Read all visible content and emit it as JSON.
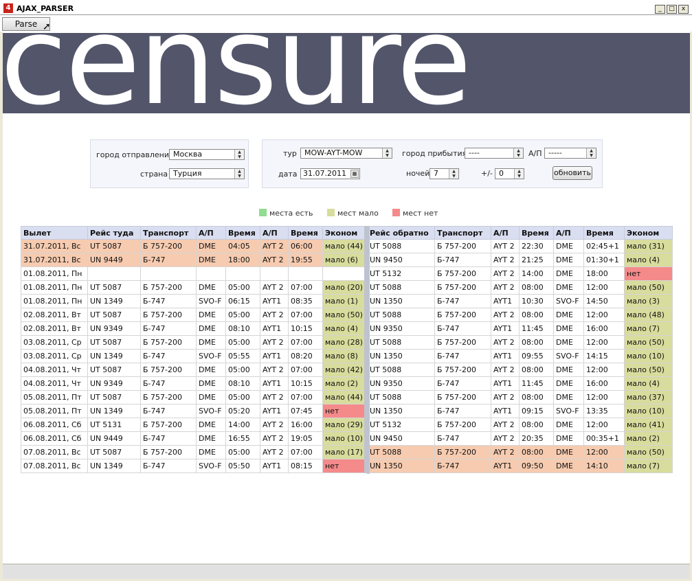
{
  "window": {
    "title": "AJAX_PARSER",
    "app_icon": "4",
    "min_glyph": "_",
    "max_glyph": "□",
    "close_glyph": "x"
  },
  "toolbar": {
    "parse_label": "Parse"
  },
  "banner": {
    "logo_text": "censure"
  },
  "form": {
    "departure_city_label": "город отправления",
    "departure_city_value": "Москва",
    "country_label": "страна",
    "country_value": "Турция",
    "tour_label": "тур",
    "tour_value": "MOW-AYT-MOW",
    "arrival_city_label": "город прибытия",
    "arrival_city_value": "----",
    "airport_label": "А/П",
    "airport_value": "-----",
    "date_label": "дата",
    "date_value": "31.07.2011",
    "nights_label": "ночей",
    "nights_value": "7",
    "plusminus_label": "+/-",
    "plusminus_value": "0",
    "refresh_label": "обновить"
  },
  "legend": {
    "available": "места есть",
    "few": "мест мало",
    "none": "мест нет",
    "colors": {
      "available": "#90dc90",
      "few": "#d8dc9c",
      "none": "#f58a8a",
      "highlight": "#f6cbb0"
    }
  },
  "table": {
    "columns": [
      "Вылет",
      "Рейс туда",
      "Транспорт",
      "А/П",
      "Время",
      "А/П",
      "Время",
      "Эконом",
      "Рейс обратно",
      "Транспорт",
      "А/П",
      "Время",
      "А/П",
      "Время",
      "Эконом"
    ],
    "rows": [
      {
        "hl_left": true,
        "hl_right": false,
        "cells": [
          "31.07.2011, Вс",
          "UT 5087",
          "Б 757-200",
          "DME",
          "04:05",
          "AYT 2",
          "06:00",
          "мало (44)",
          "UT 5088",
          "Б 757-200",
          "AYT 2",
          "22:30",
          "DME",
          "02:45+1",
          "мало (31)"
        ]
      },
      {
        "hl_left": true,
        "hl_right": false,
        "cells": [
          "31.07.2011, Вс",
          "UN 9449",
          "Б-747",
          "DME",
          "18:00",
          "AYT 2",
          "19:55",
          "мало (6)",
          "UN 9450",
          "Б-747",
          "AYT 2",
          "21:25",
          "DME",
          "01:30+1",
          "мало (4)"
        ]
      },
      {
        "hl_left": false,
        "hl_right": false,
        "cells": [
          "01.08.2011, Пн",
          "",
          "",
          "",
          "",
          "",
          "",
          "",
          "UT 5132",
          "Б 757-200",
          "AYT 2",
          "14:00",
          "DME",
          "18:00",
          "нет"
        ]
      },
      {
        "hl_left": false,
        "hl_right": false,
        "cells": [
          "01.08.2011, Пн",
          "UT 5087",
          "Б 757-200",
          "DME",
          "05:00",
          "AYT 2",
          "07:00",
          "мало (20)",
          "UT 5088",
          "Б 757-200",
          "AYT 2",
          "08:00",
          "DME",
          "12:00",
          "мало (50)"
        ]
      },
      {
        "hl_left": false,
        "hl_right": false,
        "cells": [
          "01.08.2011, Пн",
          "UN 1349",
          "Б-747",
          "SVO-F",
          "06:15",
          "AYT1",
          "08:35",
          "мало (1)",
          "UN 1350",
          "Б-747",
          "AYT1",
          "10:30",
          "SVO-F",
          "14:50",
          "мало (3)"
        ]
      },
      {
        "hl_left": false,
        "hl_right": false,
        "cells": [
          "02.08.2011, Вт",
          "UT 5087",
          "Б 757-200",
          "DME",
          "05:00",
          "AYT 2",
          "07:00",
          "мало (50)",
          "UT 5088",
          "Б 757-200",
          "AYT 2",
          "08:00",
          "DME",
          "12:00",
          "мало (48)"
        ]
      },
      {
        "hl_left": false,
        "hl_right": false,
        "cells": [
          "02.08.2011, Вт",
          "UN 9349",
          "Б-747",
          "DME",
          "08:10",
          "AYT1",
          "10:15",
          "мало (4)",
          "UN 9350",
          "Б-747",
          "AYT1",
          "11:45",
          "DME",
          "16:00",
          "мало (7)"
        ]
      },
      {
        "hl_left": false,
        "hl_right": false,
        "cells": [
          "03.08.2011, Ср",
          "UT 5087",
          "Б 757-200",
          "DME",
          "05:00",
          "AYT 2",
          "07:00",
          "мало (28)",
          "UT 5088",
          "Б 757-200",
          "AYT 2",
          "08:00",
          "DME",
          "12:00",
          "мало (50)"
        ]
      },
      {
        "hl_left": false,
        "hl_right": false,
        "cells": [
          "03.08.2011, Ср",
          "UN 1349",
          "Б-747",
          "SVO-F",
          "05:55",
          "AYT1",
          "08:20",
          "мало (8)",
          "UN 1350",
          "Б-747",
          "AYT1",
          "09:55",
          "SVO-F",
          "14:15",
          "мало (10)"
        ]
      },
      {
        "hl_left": false,
        "hl_right": false,
        "cells": [
          "04.08.2011, Чт",
          "UT 5087",
          "Б 757-200",
          "DME",
          "05:00",
          "AYT 2",
          "07:00",
          "мало (42)",
          "UT 5088",
          "Б 757-200",
          "AYT 2",
          "08:00",
          "DME",
          "12:00",
          "мало (50)"
        ]
      },
      {
        "hl_left": false,
        "hl_right": false,
        "cells": [
          "04.08.2011, Чт",
          "UN 9349",
          "Б-747",
          "DME",
          "08:10",
          "AYT1",
          "10:15",
          "мало (2)",
          "UN 9350",
          "Б-747",
          "AYT1",
          "11:45",
          "DME",
          "16:00",
          "мало (4)"
        ]
      },
      {
        "hl_left": false,
        "hl_right": false,
        "cells": [
          "05.08.2011, Пт",
          "UT 5087",
          "Б 757-200",
          "DME",
          "05:00",
          "AYT 2",
          "07:00",
          "мало (44)",
          "UT 5088",
          "Б 757-200",
          "AYT 2",
          "08:00",
          "DME",
          "12:00",
          "мало (37)"
        ]
      },
      {
        "hl_left": false,
        "hl_right": false,
        "cells": [
          "05.08.2011, Пт",
          "UN 1349",
          "Б-747",
          "SVO-F",
          "05:20",
          "AYT1",
          "07:45",
          "нет",
          "UN 1350",
          "Б-747",
          "AYT1",
          "09:15",
          "SVO-F",
          "13:35",
          "мало (10)"
        ]
      },
      {
        "hl_left": false,
        "hl_right": false,
        "cells": [
          "06.08.2011, Сб",
          "UT 5131",
          "Б 757-200",
          "DME",
          "14:00",
          "AYT 2",
          "16:00",
          "мало (29)",
          "UT 5132",
          "Б 757-200",
          "AYT 2",
          "08:00",
          "DME",
          "12:00",
          "мало (41)"
        ]
      },
      {
        "hl_left": false,
        "hl_right": false,
        "cells": [
          "06.08.2011, Сб",
          "UN 9449",
          "Б-747",
          "DME",
          "16:55",
          "AYT 2",
          "19:05",
          "мало (10)",
          "UN 9450",
          "Б-747",
          "AYT 2",
          "20:35",
          "DME",
          "00:35+1",
          "мало (2)"
        ]
      },
      {
        "hl_left": false,
        "hl_right": true,
        "cells": [
          "07.08.2011, Вс",
          "UT 5087",
          "Б 757-200",
          "DME",
          "05:00",
          "AYT 2",
          "07:00",
          "мало (17)",
          "UT 5088",
          "Б 757-200",
          "AYT 2",
          "08:00",
          "DME",
          "12:00",
          "мало (50)"
        ]
      },
      {
        "hl_left": false,
        "hl_right": true,
        "cells": [
          "07.08.2011, Вс",
          "UN 1349",
          "Б-747",
          "SVO-F",
          "05:50",
          "AYT1",
          "08:15",
          "нет",
          "UN 1350",
          "Б-747",
          "AYT1",
          "09:50",
          "DME",
          "14:10",
          "мало (7)"
        ]
      }
    ]
  }
}
